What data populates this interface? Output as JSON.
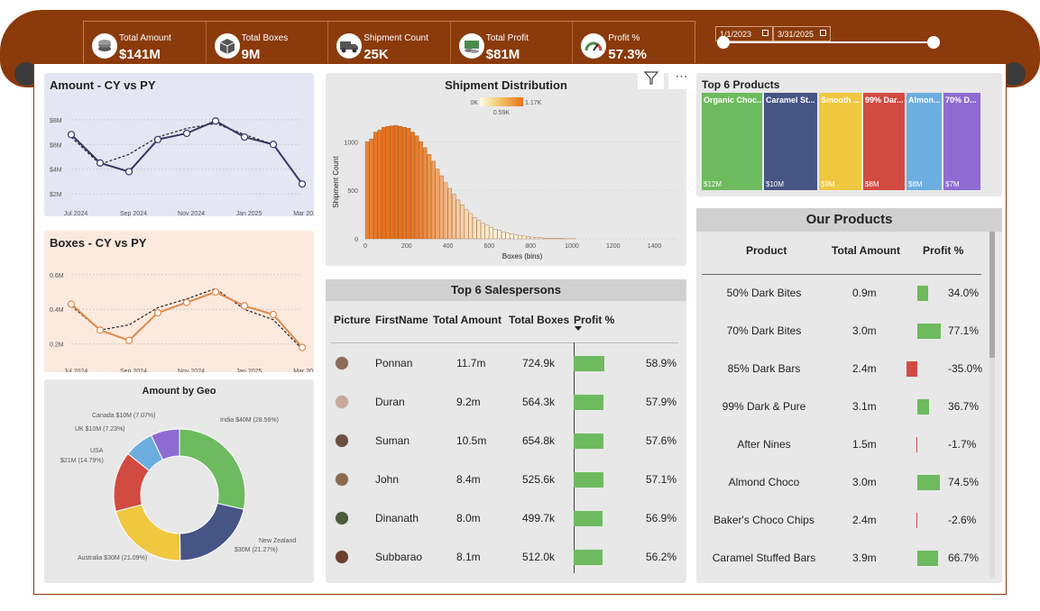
{
  "kpis": [
    {
      "label": "Total Amount",
      "value": "$141M",
      "icon": "coins-icon"
    },
    {
      "label": "Total Boxes",
      "value": "9M",
      "icon": "box-icon"
    },
    {
      "label": "Shipment Count",
      "value": "25K",
      "icon": "truck-icon"
    },
    {
      "label": "Total Profit",
      "value": "$81M",
      "icon": "money-icon"
    },
    {
      "label": "Profit %",
      "value": "57.3%",
      "icon": "gauge-icon"
    }
  ],
  "date_filter": {
    "start": "1/1/2023",
    "end": "3/31/2025"
  },
  "amount_chart": {
    "title": "Amount - CY vs PY",
    "x_ticks": [
      "Jul 2024",
      "Sep 2024",
      "Nov 2024",
      "Jan 2025",
      "Mar 2025"
    ],
    "y_ticks": [
      "$8M",
      "$6M",
      "$4M",
      "$2M"
    ],
    "cy": [
      6.8,
      4.5,
      3.8,
      6.4,
      6.9,
      7.9,
      6.6,
      6.0,
      2.8
    ],
    "py": [
      6.6,
      4.4,
      5.2,
      6.6,
      7.3,
      7.7,
      6.8,
      6.0,
      2.8
    ]
  },
  "boxes_chart": {
    "title": "Boxes - CY vs PY",
    "x_ticks": [
      "Jul 2024",
      "Sep 2024",
      "Nov 2024",
      "Jan 2025",
      "Mar 2025"
    ],
    "y_ticks": [
      "0.6M",
      "0.4M",
      "0.2M"
    ],
    "cy": [
      0.43,
      0.28,
      0.22,
      0.38,
      0.44,
      0.5,
      0.42,
      0.37,
      0.18
    ],
    "py": [
      0.42,
      0.28,
      0.31,
      0.41,
      0.46,
      0.52,
      0.4,
      0.34,
      0.17
    ]
  },
  "geo": {
    "title": "Amount by Geo",
    "slices": [
      {
        "label": "India $40M (28.56%)",
        "value": 28.56,
        "color": "#6dbb5e"
      },
      {
        "label": "New Zealand $30M (21.27%)",
        "value": 21.27,
        "color": "#475585"
      },
      {
        "label": "Australia $30M (21.09%)",
        "value": 21.09,
        "color": "#efc840"
      },
      {
        "label": "USA $21M (14.79%)",
        "value": 14.79,
        "color": "#d24b43"
      },
      {
        "label": "UK $10M (7.23%)",
        "value": 7.23,
        "color": "#6daee0"
      },
      {
        "label": "Canada $10M (7.07%)",
        "value": 7.07,
        "color": "#8e6bd1"
      }
    ],
    "label_lines": {
      "india": "India $40M (28.56%)",
      "nz1": "New Zealand",
      "nz2": "$30M (21.27%)",
      "au": "Australia $30M (21.09%)",
      "usa1": "USA",
      "usa2": "$21M (14.79%)",
      "uk": "UK $10M (7.23%)",
      "ca": "Canada $10M (7.07%)"
    }
  },
  "shipment": {
    "title": "Shipment Distribution",
    "legend_min": "0K",
    "legend_max": "1.17K",
    "legend_mid": "0.59K",
    "ylabel": "Shipment Count",
    "xlabel": "Boxes (bins)",
    "x_ticks": [
      "0",
      "200",
      "400",
      "600",
      "800",
      "1000",
      "1200",
      "1400"
    ],
    "y_ticks": [
      "1000",
      "500",
      "0"
    ],
    "bin_width": 20,
    "counts": [
      1000,
      1030,
      1100,
      1120,
      1150,
      1160,
      1165,
      1170,
      1160,
      1150,
      1140,
      1100,
      1060,
      1000,
      940,
      870,
      800,
      720,
      650,
      580,
      520,
      460,
      400,
      350,
      300,
      260,
      220,
      190,
      160,
      140,
      120,
      100,
      85,
      72,
      60,
      50,
      42,
      35,
      28,
      22,
      18,
      14,
      11,
      8,
      6,
      4,
      3,
      2,
      1,
      1,
      1,
      0,
      0,
      0
    ]
  },
  "top_products": {
    "title": "Top 6 Products",
    "items": [
      {
        "name": "Organic Choc...",
        "value": "$12M",
        "color": "#6dbb5e"
      },
      {
        "name": "Caramel St...",
        "value": "$10M",
        "color": "#475585"
      },
      {
        "name": "Smooth ...",
        "value": "$9M",
        "color": "#efc840"
      },
      {
        "name": "99% Dar...",
        "value": "$8M",
        "color": "#d24b43"
      },
      {
        "name": "Almon...",
        "value": "$8M",
        "color": "#6daee0"
      },
      {
        "name": "70% D...",
        "value": "$7M",
        "color": "#8e6bd1"
      }
    ]
  },
  "salespersons": {
    "title": "Top 6 Salespersons",
    "headers": [
      "Picture",
      "FirstName",
      "Total Amount",
      "Total Boxes",
      "Profit %"
    ],
    "rows": [
      {
        "name": "Ponnan",
        "amount": "11.7m",
        "boxes": "724.9k",
        "profit": "58.9%",
        "pv": 58.9
      },
      {
        "name": "Duran",
        "amount": "9.2m",
        "boxes": "564.3k",
        "profit": "57.9%",
        "pv": 57.9
      },
      {
        "name": "Suman",
        "amount": "10.5m",
        "boxes": "654.8k",
        "profit": "57.6%",
        "pv": 57.6
      },
      {
        "name": "John",
        "amount": "8.4m",
        "boxes": "525.6k",
        "profit": "57.1%",
        "pv": 57.1
      },
      {
        "name": "Dinanath",
        "amount": "8.0m",
        "boxes": "499.7k",
        "profit": "56.9%",
        "pv": 56.9
      },
      {
        "name": "Subbarao",
        "amount": "8.1m",
        "boxes": "512.0k",
        "profit": "56.2%",
        "pv": 56.2
      }
    ]
  },
  "our_products": {
    "title": "Our Products",
    "headers": [
      "Product",
      "Total Amount",
      "Profit %"
    ],
    "rows": [
      {
        "name": "50% Dark Bites",
        "amount": "0.9m",
        "profit": "34.0%",
        "pv": 34.0
      },
      {
        "name": "70% Dark Bites",
        "amount": "3.0m",
        "profit": "77.1%",
        "pv": 77.1
      },
      {
        "name": "85% Dark Bars",
        "amount": "2.4m",
        "profit": "-35.0%",
        "pv": -35.0
      },
      {
        "name": "99% Dark & Pure",
        "amount": "3.1m",
        "profit": "36.7%",
        "pv": 36.7
      },
      {
        "name": "After Nines",
        "amount": "1.5m",
        "profit": "-1.7%",
        "pv": -1.7
      },
      {
        "name": "Almond Choco",
        "amount": "3.0m",
        "profit": "74.5%",
        "pv": 74.5
      },
      {
        "name": "Baker's Choco Chips",
        "amount": "2.4m",
        "profit": "-2.6%",
        "pv": -2.6
      },
      {
        "name": "Caramel Stuffed Bars",
        "amount": "3.9m",
        "profit": "66.7%",
        "pv": 66.7
      }
    ]
  }
}
